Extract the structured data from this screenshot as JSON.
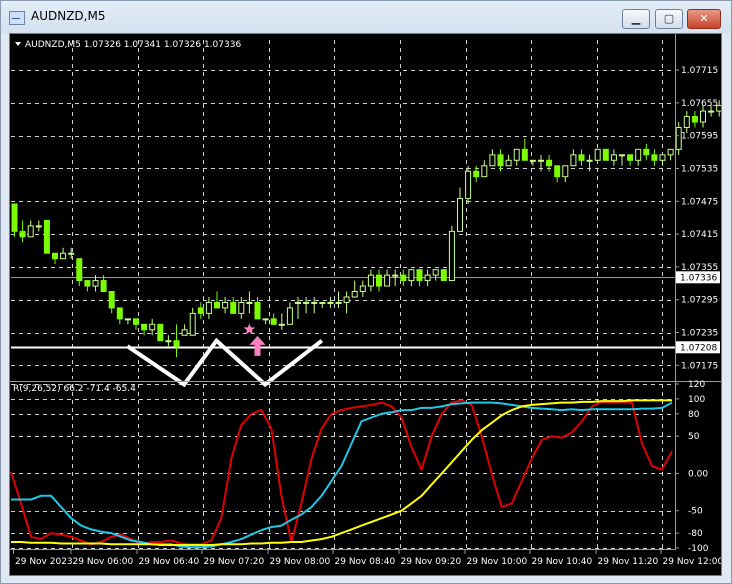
{
  "window": {
    "title": "AUDNZD,M5",
    "buttons": {
      "minimize": "▁",
      "maximize": "▢",
      "close": "✕"
    }
  },
  "colors": {
    "background": "#000000",
    "grid": "#cfcfcf",
    "candle_bull": "#c8ff8c",
    "candle_bear": "#7cfc00",
    "rsi_line": "#e00000",
    "cyan_line": "#1ec8e6",
    "yellow_line": "#ffff00",
    "arrow": "#ff80c0",
    "zigzag": "#ffffff"
  },
  "chart_data": [
    {
      "type": "candlestick",
      "title": "AUDNZD,M5 1.07326 1.07341 1.07326 1.07336",
      "ylim": [
        1.0715,
        1.0777
      ],
      "y_ticks": [
        "1.07715",
        "1.07655",
        "1.07595",
        "1.07535",
        "1.07475",
        "1.07415",
        "1.07355",
        "1.07295",
        "1.07235",
        "1.07175"
      ],
      "price_tags": [
        {
          "label": "1.07336",
          "value": 1.07336
        },
        {
          "label": "1.07208",
          "value": 1.07208
        }
      ],
      "horizontal_lines": [
        1.07336,
        1.07208
      ],
      "grid": true,
      "candles": [
        [
          1.0747,
          1.0747,
          1.0741,
          1.0742
        ],
        [
          1.0742,
          1.0744,
          1.074,
          1.0741
        ],
        [
          1.0741,
          1.0744,
          1.0741,
          1.0743
        ],
        [
          1.0743,
          1.0744,
          1.0742,
          1.0743
        ],
        [
          1.0744,
          1.0744,
          1.0738,
          1.0738
        ],
        [
          1.0738,
          1.0738,
          1.0736,
          1.0737
        ],
        [
          1.0737,
          1.0739,
          1.0737,
          1.0738
        ],
        [
          1.0738,
          1.0739,
          1.0737,
          1.0738
        ],
        [
          1.0737,
          1.0737,
          1.0732,
          1.0733
        ],
        [
          1.0733,
          1.0733,
          1.0731,
          1.0732
        ],
        [
          1.0732,
          1.0734,
          1.0731,
          1.0733
        ],
        [
          1.0733,
          1.0734,
          1.0731,
          1.0731
        ],
        [
          1.0731,
          1.0731,
          1.0727,
          1.0728
        ],
        [
          1.0728,
          1.0728,
          1.0725,
          1.0726
        ],
        [
          1.0726,
          1.0726,
          1.0725,
          1.0726
        ],
        [
          1.0726,
          1.0726,
          1.0724,
          1.0725
        ],
        [
          1.0725,
          1.0725,
          1.0723,
          1.0724
        ],
        [
          1.0724,
          1.0726,
          1.0723,
          1.0725
        ],
        [
          1.0725,
          1.0725,
          1.0722,
          1.0722
        ],
        [
          1.0722,
          1.0723,
          1.0721,
          1.0722
        ],
        [
          1.0722,
          1.0725,
          1.0719,
          1.0721
        ],
        [
          1.0723,
          1.0725,
          1.0723,
          1.0724
        ],
        [
          1.0723,
          1.0728,
          1.0723,
          1.0727
        ],
        [
          1.0728,
          1.0729,
          1.0726,
          1.0727
        ],
        [
          1.0727,
          1.073,
          1.0726,
          1.0729
        ],
        [
          1.0729,
          1.0731,
          1.0728,
          1.0728
        ],
        [
          1.0728,
          1.073,
          1.0727,
          1.0729
        ],
        [
          1.0729,
          1.073,
          1.0727,
          1.0727
        ],
        [
          1.0727,
          1.073,
          1.0726,
          1.0729
        ],
        [
          1.0729,
          1.0731,
          1.0727,
          1.0729
        ],
        [
          1.0729,
          1.073,
          1.0726,
          1.0726
        ],
        [
          1.0726,
          1.0726,
          1.0725,
          1.0726
        ],
        [
          1.0726,
          1.0727,
          1.0725,
          1.0725
        ],
        [
          1.0725,
          1.0727,
          1.0724,
          1.0725
        ],
        [
          1.0725,
          1.0729,
          1.0725,
          1.0728
        ],
        [
          1.0729,
          1.073,
          1.0726,
          1.0729
        ],
        [
          1.0729,
          1.073,
          1.0727,
          1.0729
        ],
        [
          1.0729,
          1.073,
          1.0727,
          1.0729
        ],
        [
          1.0729,
          1.0729,
          1.0728,
          1.0729
        ],
        [
          1.0729,
          1.073,
          1.0728,
          1.0729
        ],
        [
          1.0729,
          1.0731,
          1.0728,
          1.0729
        ],
        [
          1.0729,
          1.0731,
          1.0727,
          1.073
        ],
        [
          1.073,
          1.0733,
          1.073,
          1.0731
        ],
        [
          1.0731,
          1.0733,
          1.073,
          1.0732
        ],
        [
          1.0732,
          1.0735,
          1.0731,
          1.0734
        ],
        [
          1.0734,
          1.0735,
          1.0731,
          1.0732
        ],
        [
          1.0732,
          1.0735,
          1.0732,
          1.0734
        ],
        [
          1.0734,
          1.0735,
          1.0732,
          1.0734
        ],
        [
          1.0734,
          1.0735,
          1.0732,
          1.0733
        ],
        [
          1.0733,
          1.0735,
          1.0732,
          1.0735
        ],
        [
          1.0735,
          1.0735,
          1.0732,
          1.0733
        ],
        [
          1.0733,
          1.0735,
          1.0732,
          1.0734
        ],
        [
          1.0734,
          1.0735,
          1.0733,
          1.0735
        ],
        [
          1.0735,
          1.0735,
          1.0733,
          1.0733
        ],
        [
          1.0733,
          1.0743,
          1.0733,
          1.0742
        ],
        [
          1.0742,
          1.075,
          1.0742,
          1.0748
        ],
        [
          1.0748,
          1.0754,
          1.0747,
          1.0753
        ],
        [
          1.0753,
          1.0754,
          1.0751,
          1.0752
        ],
        [
          1.0752,
          1.0755,
          1.0752,
          1.0754
        ],
        [
          1.0754,
          1.0757,
          1.0754,
          1.0756
        ],
        [
          1.0756,
          1.0757,
          1.0753,
          1.0754
        ],
        [
          1.0754,
          1.0756,
          1.0754,
          1.0755
        ],
        [
          1.0755,
          1.0757,
          1.0754,
          1.0757
        ],
        [
          1.0757,
          1.0759,
          1.0755,
          1.0755
        ],
        [
          1.0755,
          1.0755,
          1.0754,
          1.0755
        ],
        [
          1.0755,
          1.0756,
          1.0753,
          1.0755
        ],
        [
          1.0755,
          1.0756,
          1.0753,
          1.0754
        ],
        [
          1.0754,
          1.0754,
          1.0751,
          1.0752
        ],
        [
          1.0752,
          1.0754,
          1.0751,
          1.0754
        ],
        [
          1.0754,
          1.0757,
          1.0754,
          1.0756
        ],
        [
          1.0756,
          1.0757,
          1.0754,
          1.0755
        ],
        [
          1.0755,
          1.0756,
          1.0753,
          1.0755
        ],
        [
          1.0755,
          1.0757,
          1.0755,
          1.0757
        ],
        [
          1.0757,
          1.0757,
          1.0755,
          1.0755
        ],
        [
          1.0755,
          1.0757,
          1.0754,
          1.0756
        ],
        [
          1.0756,
          1.0756,
          1.0754,
          1.0756
        ],
        [
          1.0756,
          1.0756,
          1.0754,
          1.0755
        ],
        [
          1.0755,
          1.0757,
          1.0754,
          1.0757
        ],
        [
          1.0757,
          1.0758,
          1.0755,
          1.0756
        ],
        [
          1.0756,
          1.0757,
          1.0754,
          1.0755
        ],
        [
          1.0755,
          1.0756,
          1.0754,
          1.0756
        ],
        [
          1.0756,
          1.0757,
          1.0755,
          1.0757
        ],
        [
          1.0757,
          1.0762,
          1.0756,
          1.0761
        ],
        [
          1.0761,
          1.0764,
          1.076,
          1.0763
        ],
        [
          1.0763,
          1.0764,
          1.0761,
          1.0762
        ],
        [
          1.0762,
          1.0765,
          1.0761,
          1.0764
        ],
        [
          1.0764,
          1.0765,
          1.0763,
          1.0764
        ],
        [
          1.0764,
          1.0766,
          1.0763,
          1.0765
        ],
        [
          1.0765,
          1.0767,
          1.0764,
          1.0766
        ],
        [
          1.0766,
          1.0768,
          1.0765,
          1.0767
        ],
        [
          1.0767,
          1.0768,
          1.0765,
          1.0766
        ],
        [
          1.0766,
          1.0768,
          1.0766,
          1.0768
        ],
        [
          1.0768,
          1.0771,
          1.0767,
          1.077
        ],
        [
          1.077,
          1.0774,
          1.0768,
          1.0772
        ],
        [
          1.0772,
          1.0772,
          1.0769,
          1.0769
        ],
        [
          1.0769,
          1.0769,
          1.0765,
          1.0766
        ],
        [
          1.0766,
          1.0769,
          1.0766,
          1.0768
        ],
        [
          1.0768,
          1.0768,
          1.0765,
          1.0766
        ],
        [
          1.0766,
          1.0768,
          1.0766,
          1.0768
        ],
        [
          1.0768,
          1.0771,
          1.0767,
          1.0769
        ],
        [
          1.0769,
          1.0771,
          1.0768,
          1.077
        ],
        [
          1.077,
          1.0772,
          1.077,
          1.0772
        ]
      ],
      "markers": [
        {
          "kind": "star",
          "candle_index": 29
        },
        {
          "kind": "up-arrow",
          "candle_index": 30
        }
      ],
      "zigzag_points": [
        [
          14,
          1.0721
        ],
        [
          21,
          1.0714
        ],
        [
          25,
          1.0722
        ],
        [
          31,
          1.0714
        ],
        [
          38,
          1.0722
        ]
      ]
    },
    {
      "type": "line",
      "title": "R(9,26,52) 66.2 -71.4 -65.4",
      "ylim": [
        -100,
        120
      ],
      "y_ticks": [
        "120",
        "100",
        "80",
        "50",
        "0.00",
        "-50",
        "-80",
        "-100"
      ],
      "grid": true,
      "series": [
        {
          "color": "#e00000",
          "values": [
            2,
            -40,
            -85,
            -88,
            -80,
            -82,
            -85,
            -90,
            -95,
            -92,
            -85,
            -82,
            -88,
            -95,
            -92,
            -92,
            -90,
            -94,
            -95,
            -95,
            -90,
            -60,
            20,
            65,
            80,
            85,
            60,
            -30,
            -92,
            -40,
            20,
            60,
            80,
            85,
            88,
            90,
            92,
            95,
            90,
            75,
            35,
            5,
            50,
            80,
            95,
            98,
            92,
            50,
            0,
            -45,
            -40,
            -10,
            20,
            45,
            50,
            48,
            55,
            70,
            90,
            96,
            95,
            96,
            95,
            40,
            10,
            5,
            30
          ]
        },
        {
          "color": "#1ec8e6",
          "values": [
            -35,
            -35,
            -35,
            -30,
            -30,
            -45,
            -60,
            -70,
            -75,
            -78,
            -80,
            -85,
            -90,
            -92,
            -95,
            -95,
            -95,
            -98,
            -99,
            -99,
            -98,
            -95,
            -92,
            -88,
            -82,
            -76,
            -72,
            -70,
            -62,
            -55,
            -45,
            -30,
            -10,
            10,
            40,
            70,
            75,
            80,
            82,
            85,
            85,
            88,
            88,
            90,
            93,
            94,
            95,
            95,
            95,
            94,
            92,
            90,
            88,
            87,
            86,
            85,
            86,
            85,
            86,
            86,
            86,
            86,
            86,
            87,
            87,
            88,
            95
          ]
        },
        {
          "color": "#ffff00",
          "values": [
            -92,
            -92,
            -93,
            -93,
            -93,
            -94,
            -94,
            -94,
            -94,
            -94,
            -95,
            -95,
            -95,
            -95,
            -95,
            -96,
            -96,
            -96,
            -96,
            -96,
            -96,
            -95,
            -95,
            -95,
            -94,
            -94,
            -93,
            -93,
            -92,
            -92,
            -90,
            -88,
            -85,
            -80,
            -75,
            -70,
            -65,
            -60,
            -55,
            -50,
            -40,
            -30,
            -15,
            0,
            15,
            30,
            45,
            58,
            68,
            78,
            85,
            90,
            92,
            93,
            94,
            95,
            95,
            96,
            96,
            97,
            97,
            97,
            98,
            98,
            98,
            98,
            98
          ]
        }
      ]
    }
  ],
  "x_axis": {
    "labels": [
      "29 Nov 2023",
      "29 Nov 06:00",
      "29 Nov 06:40",
      "29 Nov 07:20",
      "29 Nov 08:00",
      "29 Nov 08:40",
      "29 Nov 09:20",
      "29 Nov 10:00",
      "29 Nov 10:40",
      "29 Nov 11:20",
      "29 Nov 12:00"
    ]
  }
}
